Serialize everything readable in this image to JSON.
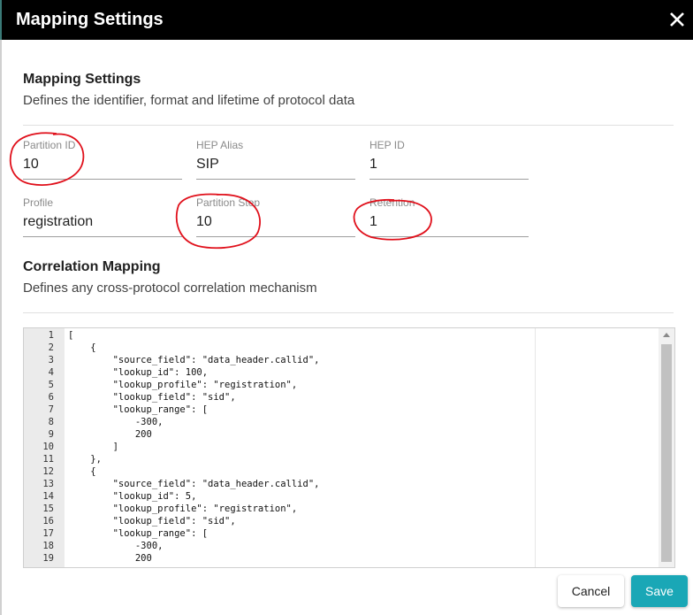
{
  "dialog": {
    "title": "Mapping Settings"
  },
  "mapping_section": {
    "title": "Mapping Settings",
    "description": "Defines the identifier, format and lifetime of protocol data"
  },
  "fields": {
    "partition_id": {
      "label": "Partition ID",
      "value": "10"
    },
    "hep_alias": {
      "label": "HEP Alias",
      "value": "SIP"
    },
    "hep_id": {
      "label": "HEP ID",
      "value": "1"
    },
    "profile": {
      "label": "Profile",
      "value": "registration"
    },
    "partition_step": {
      "label": "Partition Step",
      "value": "10"
    },
    "retention": {
      "label": "Retention",
      "value": "1"
    }
  },
  "correlation_section": {
    "title": "Correlation Mapping",
    "description": "Defines any cross-protocol correlation mechanism"
  },
  "editor": {
    "line_numbers": [
      "1",
      "2",
      "3",
      "4",
      "5",
      "6",
      "7",
      "8",
      "9",
      "10",
      "11",
      "12",
      "13",
      "14",
      "15",
      "16",
      "17",
      "18",
      "19"
    ],
    "lines": [
      "[",
      "    {",
      "        \"source_field\": \"data_header.callid\",",
      "        \"lookup_id\": 100,",
      "        \"lookup_profile\": \"registration\",",
      "        \"lookup_field\": \"sid\",",
      "        \"lookup_range\": [",
      "            -300,",
      "            200",
      "        ]",
      "    },",
      "    {",
      "        \"source_field\": \"data_header.callid\",",
      "        \"lookup_id\": 5,",
      "        \"lookup_profile\": \"registration\",",
      "        \"lookup_field\": \"sid\",",
      "        \"lookup_range\": [",
      "            -300,",
      "            200"
    ]
  },
  "buttons": {
    "cancel": "Cancel",
    "save": "Save"
  },
  "colors": {
    "titlebar": "#000000",
    "save_button": "#1aa7b6",
    "annotation": "#e0101b"
  },
  "icons": {
    "close": "close-icon",
    "scroll_up": "chevron-up-icon"
  }
}
